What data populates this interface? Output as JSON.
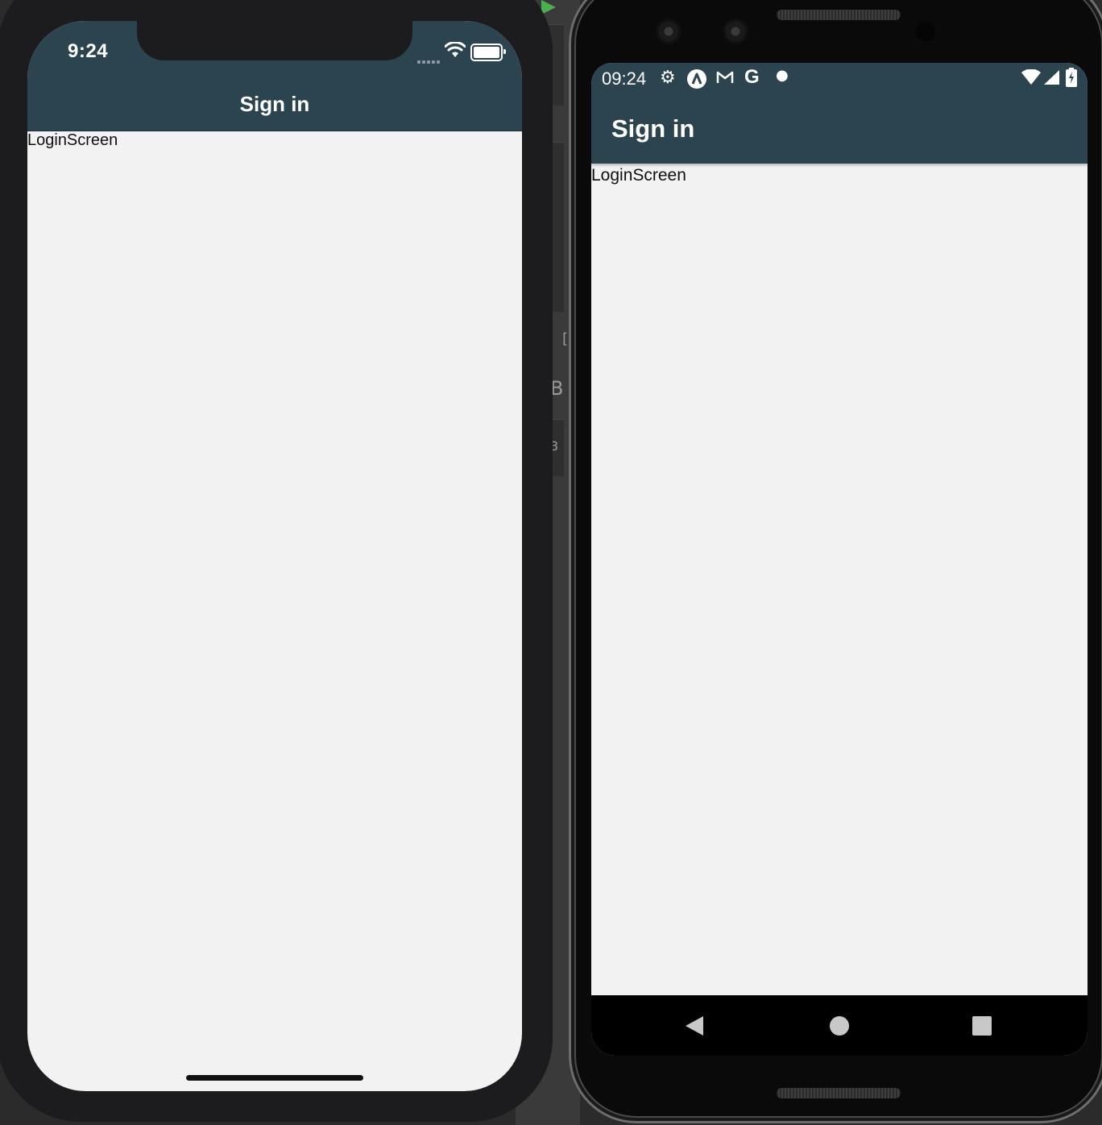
{
  "ios": {
    "status_time": "9:24",
    "header_title": "Sign in",
    "content_text": "LoginScreen"
  },
  "android": {
    "status_time": "09:24",
    "status_icons": [
      "gear-icon",
      "angular-icon",
      "gmail-icon",
      "google-icon",
      "dot-icon"
    ],
    "right_icons": [
      "wifi-icon",
      "cell-signal-icon",
      "battery-charging-icon"
    ],
    "appbar_title": "Sign in",
    "content_text": "LoginScreen",
    "nav_buttons": [
      "back-button",
      "home-button",
      "recents-button"
    ]
  },
  "background": {
    "glyphs": [
      "B",
      "[",
      "3"
    ]
  },
  "colors": {
    "header_bg": "#2c4450",
    "screen_bg": "#f2f2f2",
    "ios_frame": "#1c1c1e",
    "android_frame": "#0a0a0a",
    "run_icon": "#4caf50"
  }
}
